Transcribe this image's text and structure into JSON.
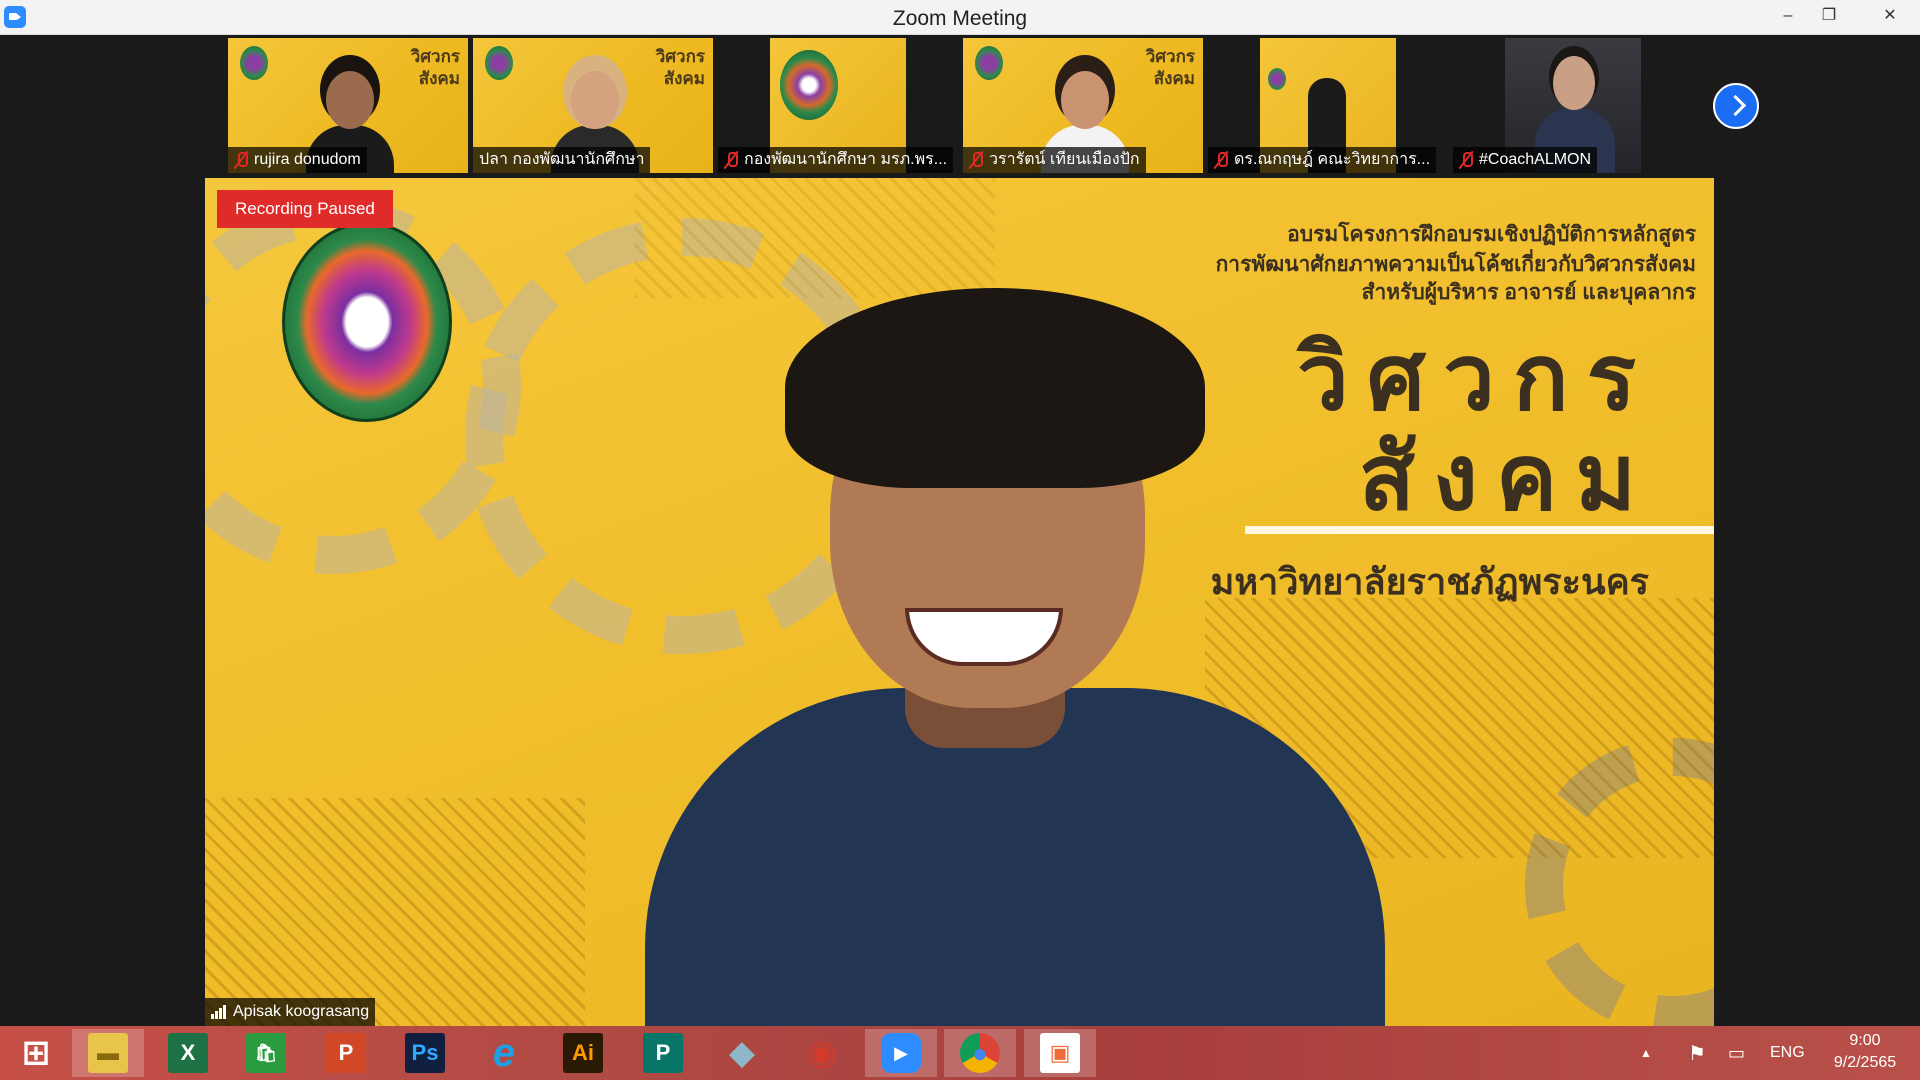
{
  "window": {
    "title": "Zoom Meeting",
    "minimize_label": "–",
    "maximize_label": "❐",
    "close_label": "✕"
  },
  "participants": [
    {
      "name": "rujira donudom",
      "muted": true
    },
    {
      "name": "ปลา กองพัฒนานักศึกษา",
      "muted": false
    },
    {
      "name": "กองพัฒนานักศึกษา มรภ.พร...",
      "muted": true
    },
    {
      "name": "วรารัตน์ เทียนเมืองปัก",
      "muted": true
    },
    {
      "name": "ดร.ณกฤษฎ์ คณะวิทยาการ...",
      "muted": true
    },
    {
      "name": "#CoachALMON",
      "muted": true
    }
  ],
  "tile_slide": {
    "title": "วิศวกร\nสังคม"
  },
  "main": {
    "recording_badge": "Recording Paused",
    "speaker_name": "Apisak koograsang",
    "slide": {
      "line1": "อบรมโครงการฝึกอบรมเชิงปฏิบัติการหลักสูตร",
      "line2": "การพัฒนาศักยภาพความเป็นโค้ชเกี่ยวกับวิศวกรสังคม",
      "line3": "สำหรับผู้บริหาร อาจารย์ และบุคลากร",
      "big1": "วิศวกร",
      "big2": "สังคม",
      "university": "มหาวิทยาลัยราชภัฏพระนคร"
    }
  },
  "taskbar": {
    "apps": [
      {
        "name": "windows-start",
        "glyph": "⊞",
        "color": "#ffffff"
      },
      {
        "name": "file-explorer",
        "glyph": "▬",
        "color": "#e8c44a"
      },
      {
        "name": "excel",
        "glyph": "X",
        "color": "#1e7145"
      },
      {
        "name": "store",
        "glyph": "🛍",
        "color": "#2a9b3f"
      },
      {
        "name": "powerpoint",
        "glyph": "P",
        "color": "#d24726"
      },
      {
        "name": "photoshop",
        "glyph": "Ps",
        "color": "#0f1f3d"
      },
      {
        "name": "internet-explorer",
        "glyph": "e",
        "color": "#1ea0e6"
      },
      {
        "name": "illustrator",
        "glyph": "Ai",
        "color": "#2a1a05"
      },
      {
        "name": "publisher",
        "glyph": "P",
        "color": "#077568"
      },
      {
        "name": "app-generic",
        "glyph": "◆",
        "color": "#8fb7c9"
      },
      {
        "name": "photoscape",
        "glyph": "◉",
        "color": "#d23b2b"
      },
      {
        "name": "zoom",
        "glyph": "▶",
        "color": "#2d8cff"
      },
      {
        "name": "chrome",
        "glyph": "●",
        "color": "#e0a526"
      },
      {
        "name": "paint",
        "glyph": "▣",
        "color": "#ef6b3a"
      }
    ],
    "language": "ENG",
    "time": "9:00",
    "date": "9/2/2565"
  }
}
